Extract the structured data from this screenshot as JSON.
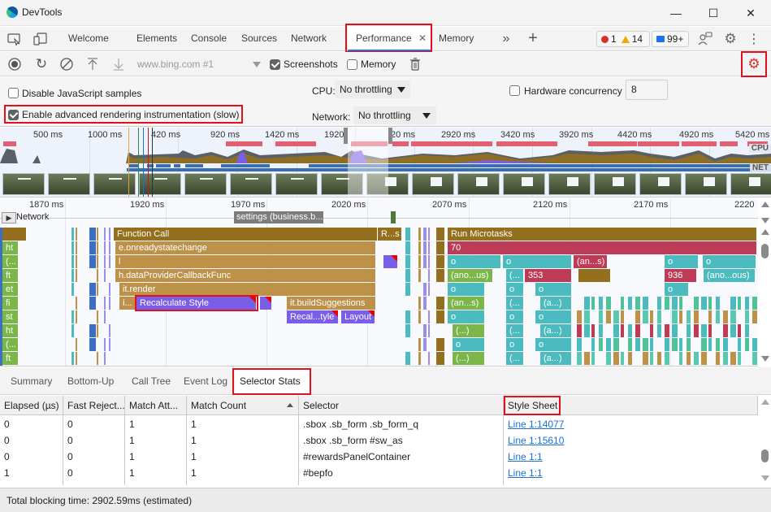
{
  "window": {
    "title": "DevTools",
    "controls": {
      "minimize": "—",
      "maximize": "☐",
      "close": "✕"
    }
  },
  "tabbar": {
    "tabs": [
      {
        "label": "Welcome"
      },
      {
        "label": "Elements"
      },
      {
        "label": "Console"
      },
      {
        "label": "Sources"
      },
      {
        "label": "Network"
      },
      {
        "label": "Performance",
        "active": true,
        "closable": true
      },
      {
        "label": "Memory"
      }
    ],
    "more_tabs_glyph": "»",
    "add_tab_glyph": "+",
    "close_glyph": "✕",
    "badges": {
      "errors": "1",
      "warnings": "14",
      "messages": "99+"
    }
  },
  "toolbar": {
    "recording_target": "www.bing.com #1",
    "screenshots_label": "Screenshots",
    "screenshots_checked": true,
    "memory_label": "Memory",
    "memory_checked": false
  },
  "settings": {
    "disable_js_samples_label": "Disable JavaScript samples",
    "disable_js_samples_checked": false,
    "advanced_rendering_label": "Enable advanced rendering instrumentation (slow)",
    "advanced_rendering_checked": true,
    "cpu_label": "CPU:",
    "cpu_value": "No throttling",
    "network_label": "Network:",
    "network_value": "No throttling",
    "hw_concurrency_label": "Hardware concurrency",
    "hw_concurrency_checked": false,
    "hw_concurrency_value": "8"
  },
  "overview": {
    "ticks": [
      "500 ms",
      "1000 ms",
      "420 ms",
      "920 ms",
      "1420 ms",
      "1920",
      "20 ms",
      "2920 ms",
      "3420 ms",
      "3920 ms",
      "4420 ms",
      "4920 ms",
      "5420 ms"
    ],
    "cpu_label": "CPU",
    "net_label": "NET"
  },
  "flamechart": {
    "ticks": [
      "1870 ms",
      "1920 ms",
      "1970 ms",
      "2020 ms",
      "2070 ms",
      "2120 ms",
      "2170 ms",
      "2220"
    ],
    "network_label": "Network",
    "network_request": "settings (business.b...",
    "left_labels": [
      "",
      "ht",
      "(...",
      "ft",
      "et",
      "fi",
      "st",
      "ht",
      "(...",
      "ft"
    ],
    "blocks": {
      "function_call": "Function Call",
      "r_s": "R...s",
      "onreadystatechange": "e.onreadystatechange",
      "l": "l",
      "data_provider": "h.dataProviderCallbackFunc",
      "render": "it.render",
      "i_ellipsis": "i...",
      "recalculate_style": "Recalculate Style",
      "build_suggestions": "it.buildSuggestions",
      "recalc_tyle": "Recal...tyle",
      "layout": "Layout",
      "run_microtasks": "Run Microtasks",
      "seventy": "70",
      "o": "o",
      "an_s": "(an...s)",
      "ano_us": "(ano...us)",
      "paren_ellipsis": "(...",
      "n353": "353",
      "n936": "936",
      "ano_ous": "(ano...ous)",
      "a_paren": "(a...)",
      "dots": "(...)"
    }
  },
  "bottom_tabs": [
    {
      "label": "Summary"
    },
    {
      "label": "Bottom-Up"
    },
    {
      "label": "Call Tree"
    },
    {
      "label": "Event Log"
    },
    {
      "label": "Selector Stats",
      "active": true
    }
  ],
  "selector_stats": {
    "columns": [
      "Elapsed (µs)",
      "Fast Reject...",
      "Match Att...",
      "Match Count",
      "Selector",
      "Style Sheet"
    ],
    "sorted_column": "Match Count",
    "rows": [
      {
        "elapsed": "0",
        "fast_reject": "0",
        "match_attempts": "1",
        "match_count": "1",
        "selector": ".sbox .sb_form .sb_form_q",
        "style_sheet": "Line 1:14077"
      },
      {
        "elapsed": "0",
        "fast_reject": "0",
        "match_attempts": "1",
        "match_count": "1",
        "selector": ".sbox .sb_form #sw_as",
        "style_sheet": "Line 1:15610"
      },
      {
        "elapsed": "0",
        "fast_reject": "0",
        "match_attempts": "1",
        "match_count": "1",
        "selector": "#rewardsPanelContainer",
        "style_sheet": "Line 1:1"
      },
      {
        "elapsed": "1",
        "fast_reject": "0",
        "match_attempts": "1",
        "match_count": "1",
        "selector": "#bepfo",
        "style_sheet": "Line 1:1"
      }
    ]
  },
  "footer": {
    "total_blocking_time": "Total blocking time: 2902.59ms (estimated)"
  },
  "colors": {
    "accent": "#1a73e8",
    "highlight_box": "#e0101c",
    "scripting": "#936f1e",
    "rendering": "#7b5ee8",
    "link": "#1a6fd8"
  }
}
